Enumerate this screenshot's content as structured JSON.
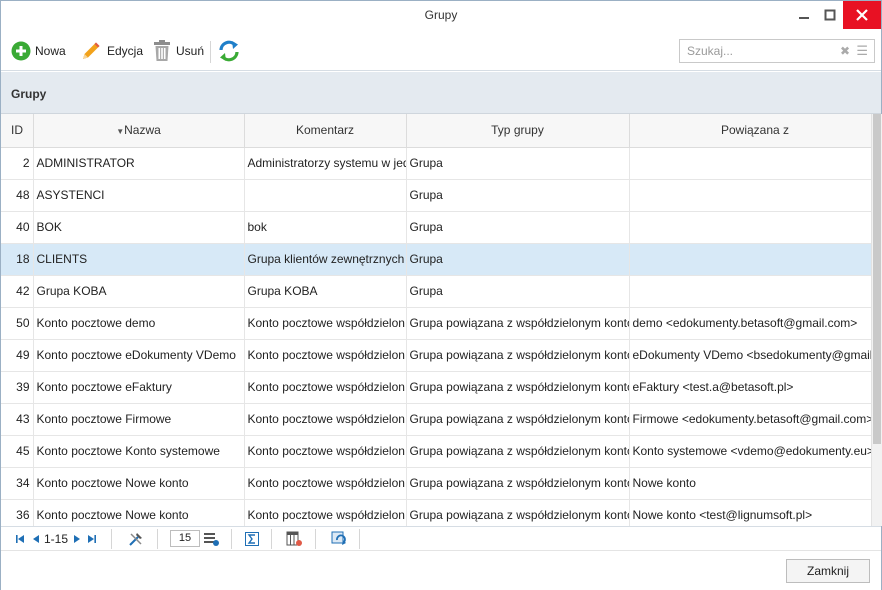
{
  "window": {
    "title": "Grupy"
  },
  "toolbar": {
    "new_label": "Nowa",
    "edit_label": "Edycja",
    "delete_label": "Usuń",
    "search_placeholder": "Szukaj..."
  },
  "panel": {
    "title": "Grupy"
  },
  "table": {
    "columns": [
      "ID",
      "Nazwa",
      "Komentarz",
      "Typ grupy",
      "Powiązana z"
    ],
    "rows": [
      [
        "2",
        "ADMINISTRATOR",
        "Administratorzy systemu w jed",
        "Grupa",
        ""
      ],
      [
        "48",
        "ASYSTENCI",
        "",
        "Grupa",
        ""
      ],
      [
        "40",
        "BOK",
        "bok",
        "Grupa",
        ""
      ],
      [
        "18",
        "CLIENTS",
        "Grupa klientów zewnętrznych",
        "Grupa",
        ""
      ],
      [
        "42",
        "Grupa KOBA",
        "Grupa KOBA",
        "Grupa",
        ""
      ],
      [
        "50",
        "Konto pocztowe demo",
        "Konto pocztowe współdzielon",
        "Grupa powiązana z współdzielonym konto",
        "demo <edokumenty.betasoft@gmail.com>"
      ],
      [
        "49",
        "Konto pocztowe eDokumenty VDemo",
        "Konto pocztowe współdzielon",
        "Grupa powiązana z współdzielonym konto",
        "eDokumenty VDemo <bsedokumenty@gmail"
      ],
      [
        "39",
        "Konto pocztowe eFaktury",
        "Konto pocztowe współdzielon",
        "Grupa powiązana z współdzielonym konto",
        "eFaktury <test.a@betasoft.pl>"
      ],
      [
        "43",
        "Konto pocztowe Firmowe",
        "Konto pocztowe współdzielon",
        "Grupa powiązana z współdzielonym konto",
        "Firmowe <edokumenty.betasoft@gmail.com>"
      ],
      [
        "45",
        "Konto pocztowe Konto systemowe",
        "Konto pocztowe współdzielon",
        "Grupa powiązana z współdzielonym konto",
        "Konto systemowe <vdemo@edokumenty.eu>"
      ],
      [
        "34",
        "Konto pocztowe Nowe konto",
        "Konto pocztowe współdzielon",
        "Grupa powiązana z współdzielonym konto",
        "Nowe konto"
      ],
      [
        "36",
        "Konto pocztowe Nowe konto",
        "Konto pocztowe współdzielon",
        "Grupa powiązana z współdzielonym konto",
        "Nowe konto <test@lignumsoft.pl>"
      ]
    ],
    "selected_index": 3
  },
  "pager": {
    "range": "1-15",
    "page_size": "15"
  },
  "footer": {
    "close_label": "Zamknij"
  },
  "colors": {
    "accent_green": "#3aaa35",
    "close_red": "#e81123",
    "selected_row": "#d7e9f7",
    "pager_blue": "#1f6fb5"
  }
}
